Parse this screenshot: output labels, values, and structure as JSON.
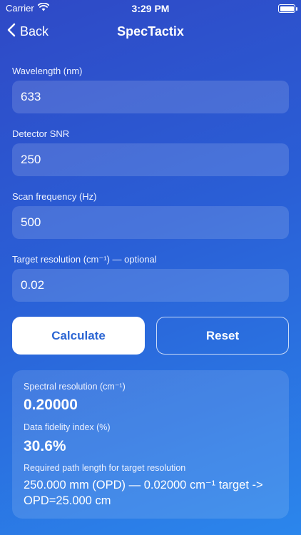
{
  "status": {
    "carrier": "Carrier",
    "time": "3:29 PM"
  },
  "nav": {
    "back_label": "Back",
    "title": "SpecTactix"
  },
  "fields": [
    {
      "label": "Wavelength (nm)",
      "value": "633"
    },
    {
      "label": "Detector SNR",
      "value": "250"
    },
    {
      "label": "Scan frequency (Hz)",
      "value": "500"
    },
    {
      "label": "Target resolution (cm⁻¹) — optional",
      "value": "0.02"
    }
  ],
  "buttons": {
    "calculate": "Calculate",
    "reset": "Reset"
  },
  "results": {
    "spectral_resolution_label": "Spectral resolution (cm⁻¹)",
    "spectral_resolution_value": "0.20000",
    "fidelity_label": "Data fidelity index (%)",
    "fidelity_value": "30.6%",
    "path_length_label": "Required path length for target resolution",
    "path_length_value": "250.000 mm (OPD) — 0.02000 cm⁻¹ target -> OPD=25.000 cm"
  },
  "icons": {
    "wifi": "wifi-icon",
    "battery": "battery-icon",
    "back": "chevron-left-icon"
  },
  "colors": {
    "accent": "#2c66d3",
    "bg_top": "#2f49c6",
    "bg_bottom": "#2b86ec"
  }
}
